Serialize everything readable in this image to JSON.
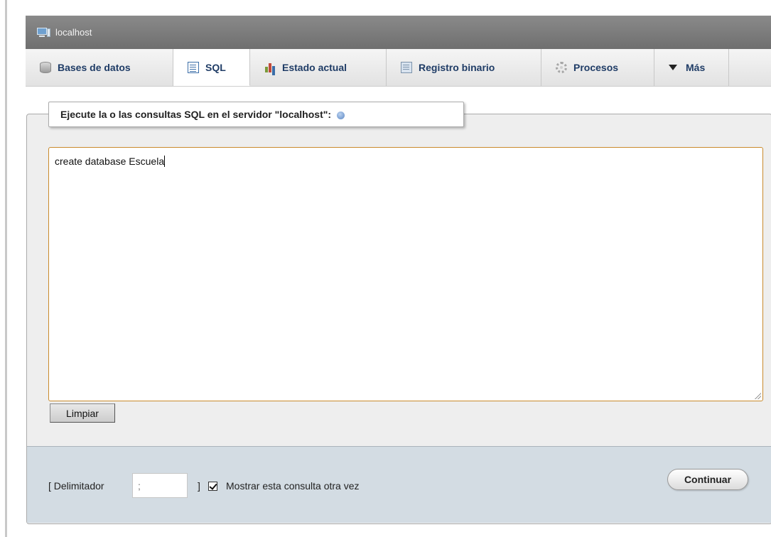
{
  "server": {
    "name": "localhost",
    "icon": "server-icon"
  },
  "tabs": [
    {
      "label": "Bases de datos",
      "icon": "database-icon",
      "active": false
    },
    {
      "label": "SQL",
      "icon": "sql-document-icon",
      "active": true
    },
    {
      "label": "Estado actual",
      "icon": "status-chart-icon",
      "active": false
    },
    {
      "label": "Registro binario",
      "icon": "binary-log-icon",
      "active": false
    },
    {
      "label": "Procesos",
      "icon": "gear-icon",
      "active": false
    },
    {
      "label": "Más",
      "icon": "triangle-down-icon",
      "active": false
    }
  ],
  "query_panel": {
    "legend": "Ejecute la o las consultas SQL en el servidor \"localhost\":",
    "help_icon": "help-icon",
    "query_text": "create database Escuela",
    "clear_label": "Limpiar"
  },
  "footer": {
    "delimiter_open": "[ Delimitador",
    "delimiter_value": ";",
    "delimiter_close": "]",
    "show_again_label": "Mostrar esta consulta otra vez",
    "show_again_checked": true,
    "submit_label": "Continuar"
  },
  "colors": {
    "server_bar": "#7d7d7d",
    "tab_text": "#1f3c66",
    "textarea_border": "#c98a2c",
    "bottom_bar": "#d3dce3"
  }
}
